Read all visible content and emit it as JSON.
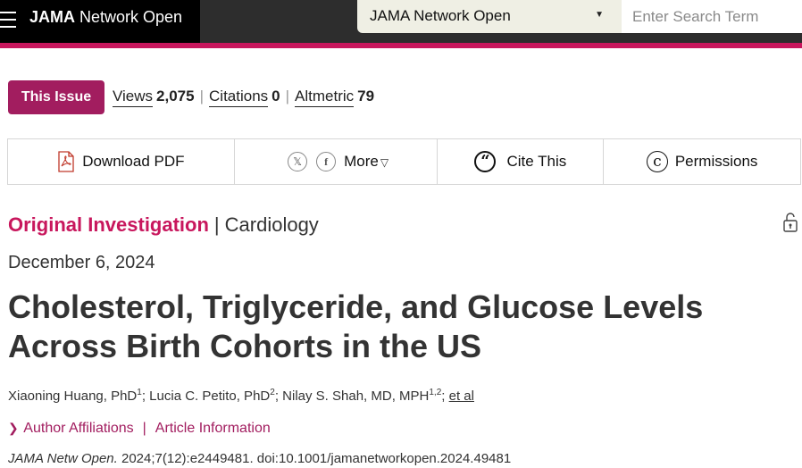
{
  "header": {
    "brand_bold": "JAMA",
    "brand_rest": " Network Open",
    "journal_select": "JAMA Network Open",
    "search_placeholder": "Enter Search Term"
  },
  "issue": {
    "button_label": "This Issue",
    "metrics": [
      {
        "label": "Views",
        "value": "2,075"
      },
      {
        "label": "Citations",
        "value": "0"
      },
      {
        "label": "Altmetric",
        "value": "79"
      }
    ]
  },
  "toolbar": {
    "download_pdf": "Download PDF",
    "more": "More",
    "cite_this": "Cite This",
    "permissions": "Permissions"
  },
  "article": {
    "type": "Original Investigation",
    "subject": "Cardiology",
    "date": "December 6, 2024",
    "title": "Cholesterol, Triglyceride, and Glucose Levels Across Birth Cohorts in the US",
    "authors": [
      {
        "name": "Xiaoning Huang, PhD",
        "sup": "1"
      },
      {
        "name": "Lucia C. Petito, PhD",
        "sup": "2"
      },
      {
        "name": "Nilay S. Shah, MD, MPH",
        "sup": "1,2"
      }
    ],
    "et_al": "et al",
    "author_affiliations": "Author Affiliations",
    "article_information": "Article Information",
    "journal_abbrev": "JAMA Netw Open.",
    "citation_rest": " 2024;7(12):e2449481. doi:10.1001/jamanetworkopen.2024.49481"
  },
  "colors": {
    "accent": "#c8175d",
    "issue_button": "#a21d5f",
    "header_bg": "#000000"
  }
}
